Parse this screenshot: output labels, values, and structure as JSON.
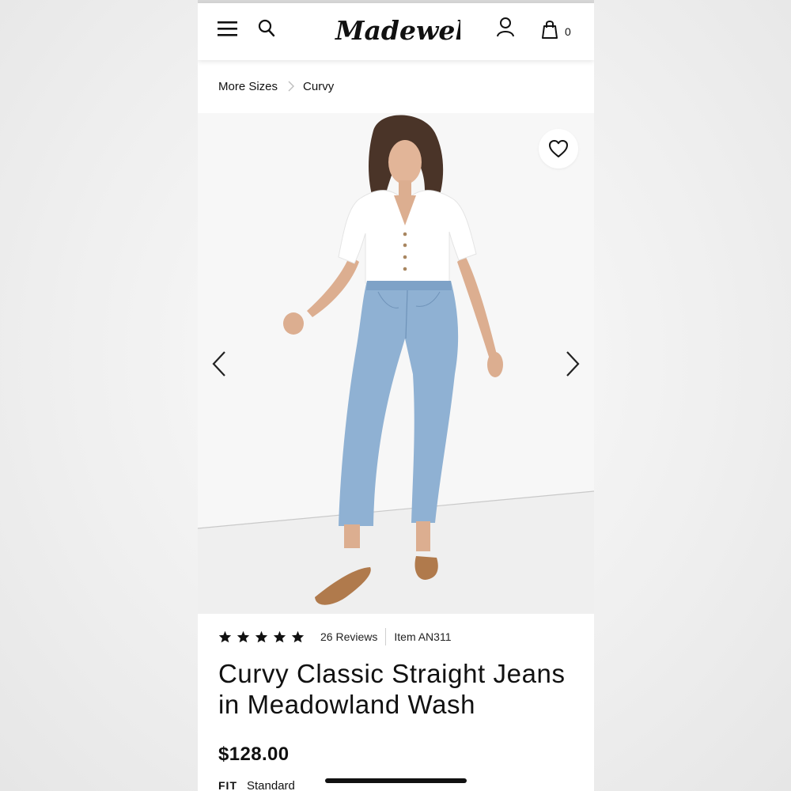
{
  "brand": {
    "logo_text": "Madewell"
  },
  "header": {
    "menu_icon": "hamburger-menu-icon",
    "search_icon": "search-icon",
    "account_icon": "user-account-icon",
    "bag_icon": "shopping-bag-icon",
    "bag_count": "0"
  },
  "breadcrumb": {
    "items": [
      {
        "label": "More Sizes"
      },
      {
        "label": "Curvy"
      }
    ],
    "separator_icon": "chevron-right-icon"
  },
  "gallery": {
    "image_alt": "Model wearing Curvy Classic Straight Jeans in Meadowland Wash",
    "favorite_icon": "heart-icon",
    "prev_icon": "chevron-left-icon",
    "next_icon": "chevron-right-icon"
  },
  "product": {
    "rating": 5,
    "rating_max": 5,
    "reviews_label": "26 Reviews",
    "item_number": "Item AN311",
    "title": "Curvy Classic Straight Jeans in Meadowland Wash",
    "price": "$128.00",
    "fit_label": "FIT",
    "fit_value": "Standard"
  },
  "colors": {
    "text": "#111111",
    "background": "#ffffff",
    "photo_backdrop": "#f6f6f6",
    "denim": "#8fb1d3"
  }
}
